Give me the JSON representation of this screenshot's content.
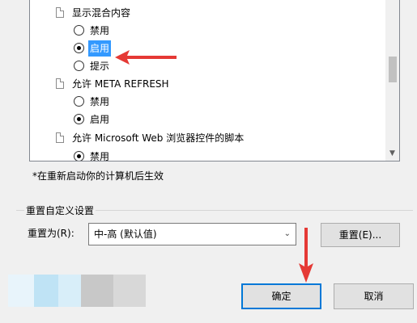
{
  "list": {
    "items": [
      {
        "kind": "header",
        "label": "显示混合内容"
      },
      {
        "kind": "radio",
        "label": "禁用",
        "checked": false,
        "selected": false
      },
      {
        "kind": "radio",
        "label": "启用",
        "checked": true,
        "selected": true
      },
      {
        "kind": "radio",
        "label": "提示",
        "checked": false,
        "selected": false
      },
      {
        "kind": "header",
        "label": "允许 META REFRESH"
      },
      {
        "kind": "radio",
        "label": "禁用",
        "checked": false,
        "selected": false
      },
      {
        "kind": "radio",
        "label": "启用",
        "checked": true,
        "selected": false
      },
      {
        "kind": "header",
        "label": "允许 Microsoft Web 浏览器控件的脚本"
      },
      {
        "kind": "radio",
        "label": "禁用",
        "checked": true,
        "selected": false
      }
    ]
  },
  "note": "*在重新启动你的计算机后生效",
  "custom": {
    "group_title": "重置自定义设置",
    "reset_to_label": "重置为(R):",
    "selected_value": "中-高 (默认值)",
    "reset_button": "重置(E)..."
  },
  "footer": {
    "ok": "确定",
    "cancel": "取消"
  },
  "colors": {
    "selection": "#3399ff",
    "annotation_arrow": "#e53935",
    "primary_border": "#0078d7"
  }
}
